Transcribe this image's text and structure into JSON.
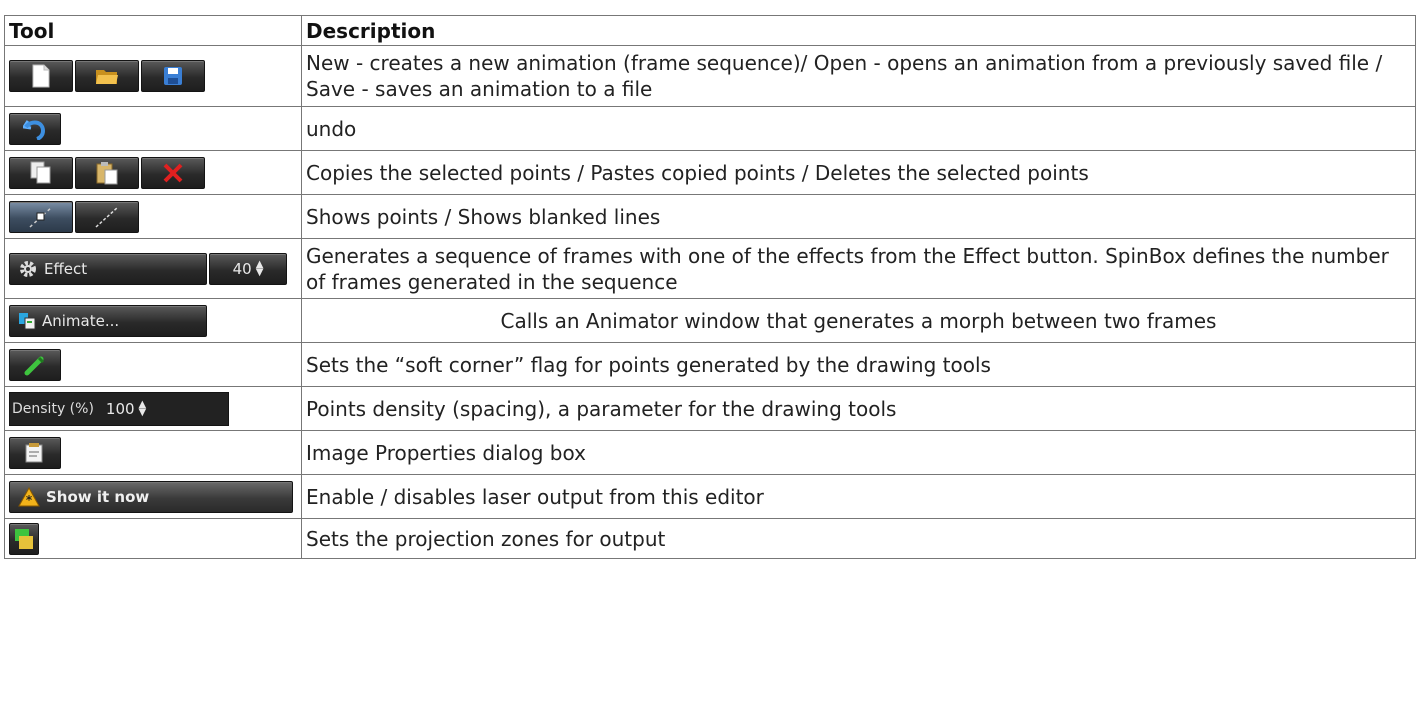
{
  "table": {
    "headers": [
      "Tool",
      "Description"
    ],
    "rows": [
      {
        "desc": "New - creates a new animation (frame sequence)/ Open - opens an animation from a previously saved file / Save - saves an animation to a file"
      },
      {
        "desc": "undo"
      },
      {
        "desc": "Copies the selected points / Pastes copied points / Deletes the selected points"
      },
      {
        "desc": "Shows points / Shows blanked lines"
      },
      {
        "desc": "Generates a sequence of frames with one of the effects from the Effect button. SpinBox defines the number of frames generated in the sequence"
      },
      {
        "desc": "Calls an Animator window that generates a morph between two frames"
      },
      {
        "desc": "Sets the “soft corner” flag for points generated by the drawing tools"
      },
      {
        "desc": "Points density (spacing), a parameter for the drawing tools"
      },
      {
        "desc": "Image Properties dialog box"
      },
      {
        "desc": "Enable / disables laser output from this editor"
      },
      {
        "desc": "Sets the projection zones for output"
      }
    ]
  },
  "tools": {
    "effect_label": "Effect",
    "effect_value": "40",
    "animate_label": "Animate...",
    "density_label": "Density (%)",
    "density_value": "100",
    "show_label": "Show it now"
  },
  "colors": {
    "toolbar_bg": "#2a2a2a",
    "folder": "#e8b43a",
    "save": "#3a7fd5",
    "undo": "#3d8fe0",
    "delete": "#e02020",
    "warning": "#f2b31a"
  },
  "icons": [
    "new-file-icon",
    "open-folder-icon",
    "save-disk-icon",
    "undo-icon",
    "copy-icon",
    "paste-icon",
    "delete-icon",
    "show-points-icon",
    "blanked-lines-icon",
    "gear-icon",
    "animate-icon",
    "soft-corner-pen-icon",
    "image-properties-icon",
    "warning-icon",
    "projection-zones-icon"
  ]
}
